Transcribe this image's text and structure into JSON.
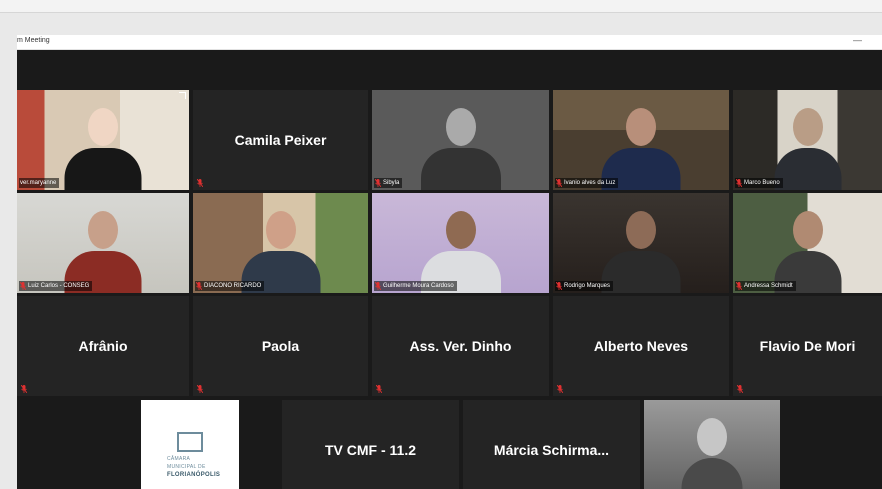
{
  "window": {
    "title": "m Meeting",
    "minimize": "—"
  },
  "colors": {
    "active_speaker": "#c9d531",
    "muted_mic": "#e03131",
    "tile_bg": "#242424"
  },
  "icons": {
    "mic": "muted-mic-icon",
    "expand": "expand-corner-icon"
  },
  "rows": [
    [
      {
        "type": "video",
        "label": "ver.maryanne",
        "muted": false,
        "speaking": true
      },
      {
        "type": "name",
        "name": "Camila Peixer",
        "muted": true
      },
      {
        "type": "video",
        "label": "Sibyla",
        "muted": true
      },
      {
        "type": "video",
        "label": "Ivanio alves da Luz",
        "muted": true
      },
      {
        "type": "video",
        "label": "Marco Bueno",
        "muted": true
      }
    ],
    [
      {
        "type": "video",
        "label": "Luiz Carlos - CONSEG",
        "muted": true
      },
      {
        "type": "video",
        "label": "DIACONO RICARDO",
        "muted": true
      },
      {
        "type": "video",
        "label": "Guilherme Moura Cardoso",
        "muted": true
      },
      {
        "type": "video",
        "label": "Rodrigo Marques",
        "muted": true
      },
      {
        "type": "video",
        "label": "Andressa Schmidt",
        "muted": true
      }
    ],
    [
      {
        "type": "name",
        "name": "Afrânio",
        "muted": true
      },
      {
        "type": "name",
        "name": "Paola",
        "muted": true
      },
      {
        "type": "name",
        "name": "Ass. Ver. Dinho",
        "muted": true
      },
      {
        "type": "name",
        "name": "Alberto Neves",
        "muted": true
      },
      {
        "type": "name",
        "name": "Flavio De Mori",
        "muted": true
      }
    ],
    [
      {
        "type": "logo",
        "logo_lines": [
          "CÂMARA",
          "MUNICIPAL DE",
          "FLORIANÓPOLIS"
        ]
      },
      {
        "type": "name",
        "name": "TV CMF - 11.2"
      },
      {
        "type": "name",
        "name": "Márcia  Schirma..."
      },
      {
        "type": "video",
        "label": ""
      }
    ]
  ]
}
